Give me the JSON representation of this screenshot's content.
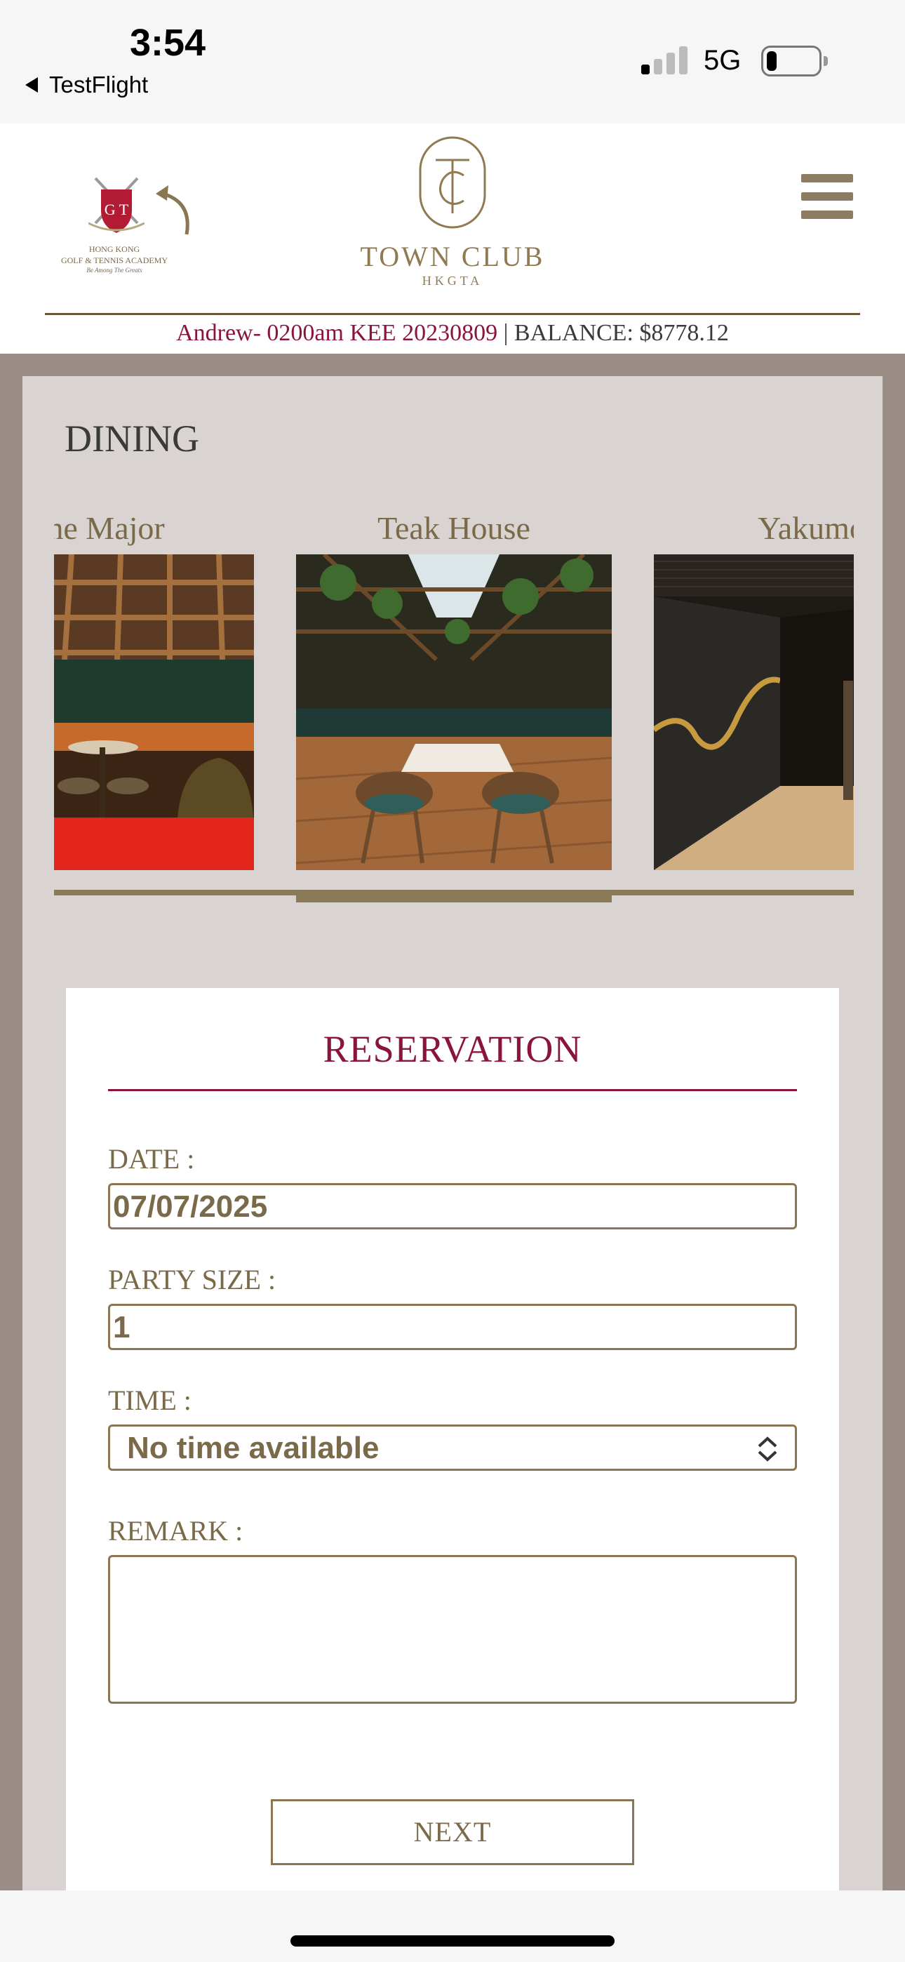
{
  "status_bar": {
    "time": "3:54",
    "back_app": "TestFlight",
    "network": "5G"
  },
  "header": {
    "academy_logo": {
      "line1": "HONG KONG",
      "line2": "GOLF & TENNIS ACADEMY",
      "tagline": "Be Among The Greats"
    },
    "town_logo": {
      "name": "TOWN CLUB",
      "sub": "HKGTA"
    },
    "account": {
      "user": "Andrew- 0200am KEE 20230809",
      "separator": " | ",
      "balance": "BALANCE: $8778.12"
    }
  },
  "section": {
    "title": "DINING"
  },
  "carousel": {
    "slides": [
      {
        "label": "The Major"
      },
      {
        "label": "Teak House"
      },
      {
        "label": "Yakumo"
      }
    ],
    "active_index": 1
  },
  "reservation": {
    "title": "RESERVATION",
    "date_label": "DATE :",
    "date_value": "07/07/2025",
    "party_label": "PARTY SIZE :",
    "party_value": "1",
    "time_label": "TIME :",
    "time_value": "No time available",
    "remark_label": "REMARK :",
    "remark_value": "",
    "next_label": "NEXT"
  },
  "colors": {
    "accent_gold": "#8b7653",
    "accent_burgundy": "#8a1538",
    "page_bg": "#9a8d86",
    "panel_bg": "#d9d4d1"
  }
}
